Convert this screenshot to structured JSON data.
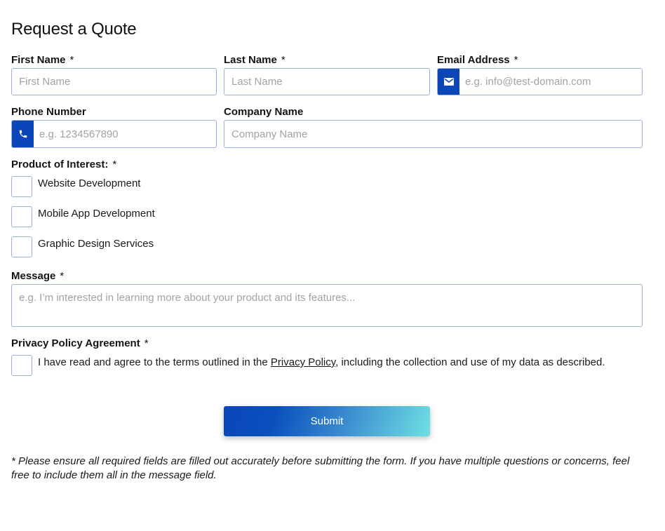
{
  "form": {
    "title": "Request a Quote",
    "required_marker": "*",
    "first_name": {
      "label": "First Name",
      "placeholder": "First Name",
      "value": ""
    },
    "last_name": {
      "label": "Last Name",
      "placeholder": "Last Name",
      "value": ""
    },
    "email": {
      "label": "Email Address",
      "placeholder": "e.g. info@test-domain.com",
      "value": "",
      "icon": "envelope-icon"
    },
    "phone": {
      "label": "Phone Number",
      "placeholder": "e.g. 1234567890",
      "value": "",
      "icon": "phone-icon"
    },
    "company": {
      "label": "Company Name",
      "placeholder": "Company Name",
      "value": ""
    },
    "product": {
      "label": "Product of Interest:",
      "options": [
        {
          "label": "Website Development",
          "checked": false
        },
        {
          "label": "Mobile App Development",
          "checked": false
        },
        {
          "label": "Graphic Design Services",
          "checked": false
        }
      ]
    },
    "message": {
      "label": "Message",
      "placeholder": "e.g. I’m interested in learning more about your product and its features...",
      "value": ""
    },
    "privacy": {
      "label": "Privacy Policy Agreement",
      "text_before": "I have read and agree to the terms outlined in the ",
      "link_text": "Privacy Policy",
      "text_after": ", including the collection and use of my data as described.",
      "checked": false
    },
    "submit_label": "Submit",
    "footnote": "* Please ensure all required fields are filled out accurately before submitting the form. If you have multiple questions or concerns, feel free to include them all in the message field."
  },
  "colors": {
    "accent": "#0b46b8",
    "gradient_end": "#6fe0e3",
    "border": "#9fb0d6",
    "placeholder": "#a3a3a3"
  }
}
